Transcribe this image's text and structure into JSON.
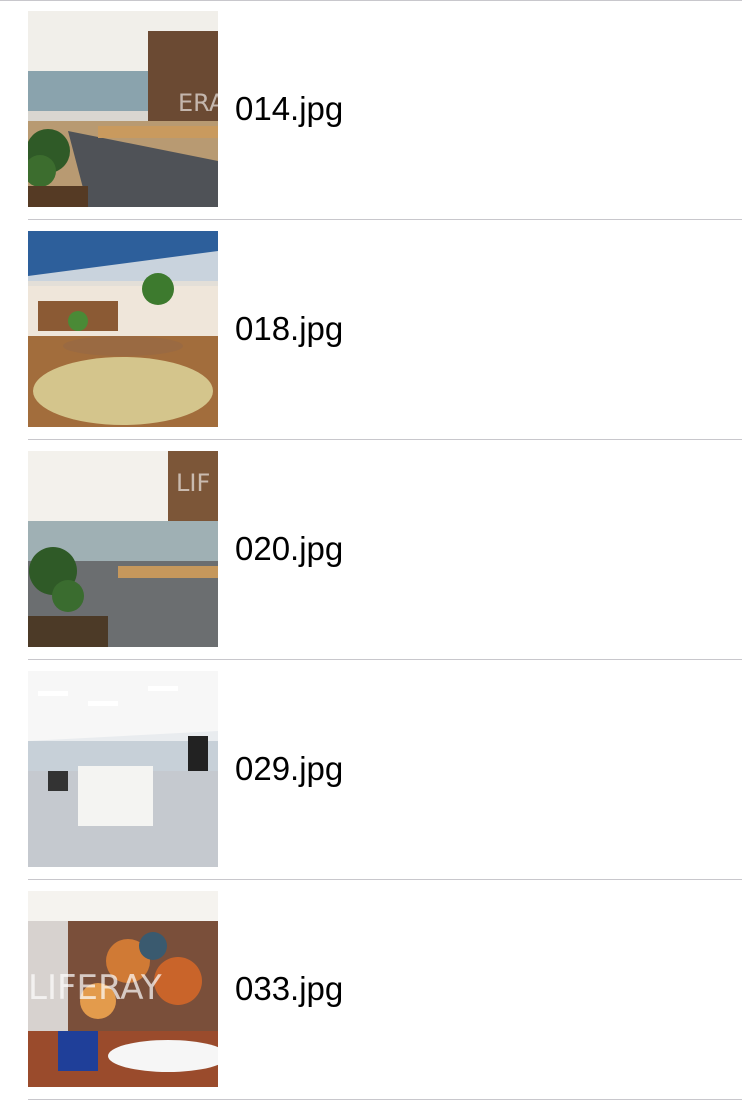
{
  "files": [
    {
      "name": "014.jpg",
      "scene": "meeting-room-plants"
    },
    {
      "name": "018.jpg",
      "scene": "open-office-table"
    },
    {
      "name": "020.jpg",
      "scene": "conference-room-glass"
    },
    {
      "name": "029.jpg",
      "scene": "open-office-desks"
    },
    {
      "name": "033.jpg",
      "scene": "lounge-liferay"
    }
  ],
  "colors": {
    "separator": "#c8c7cc",
    "text": "#000000",
    "background": "#ffffff"
  }
}
